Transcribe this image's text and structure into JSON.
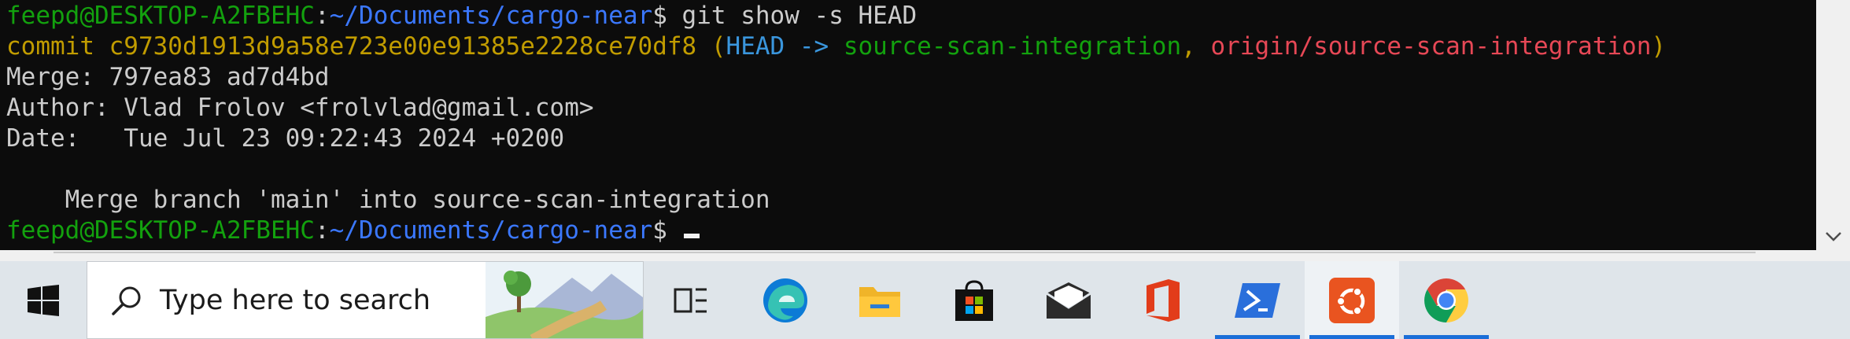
{
  "terminal": {
    "prompt": {
      "user_host": "feepd@DESKTOP-A2FBEHC",
      "separator": ":",
      "path": "~/Documents/cargo-near",
      "dollar": "$"
    },
    "command": " git show -s HEAD",
    "commit": {
      "prefix": "commit c9730d1913d9a58e723e00e91385e2228ce70df8",
      "open_paren": " (",
      "head_arrow": "HEAD ->",
      "local_branch": " source-scan-integration",
      "comma": ",",
      "remote_branch": " origin/source-scan-integration",
      "close_paren": ")"
    },
    "merge_line": "Merge: 797ea83 ad7d4bd",
    "author_line": "Author: Vlad Frolov <frolvlad@gmail.com>",
    "date_line": "Date:   Tue Jul 23 09:22:43 2024 +0200",
    "message_line": "    Merge branch 'main' into source-scan-integration"
  },
  "colors": {
    "background": "#0c0c0c",
    "text": "#cccccc",
    "prompt_user": "#13a10e",
    "prompt_path": "#3b78ff",
    "commit_yellow": "#c19c00",
    "head_cyan": "#3a96dd",
    "branch_green": "#13a10e",
    "remote_red": "#e74856",
    "taskbar": "#dfe5ea",
    "taskbar_accent": "#1a6ed8"
  },
  "taskbar": {
    "search_placeholder": "Type here to search",
    "icons": [
      "windows-start-icon",
      "search-icon",
      "task-view-icon",
      "edge-icon",
      "file-explorer-icon",
      "microsoft-store-icon",
      "mail-icon",
      "office-icon",
      "powershell-icon",
      "ubuntu-icon",
      "chrome-icon"
    ]
  }
}
